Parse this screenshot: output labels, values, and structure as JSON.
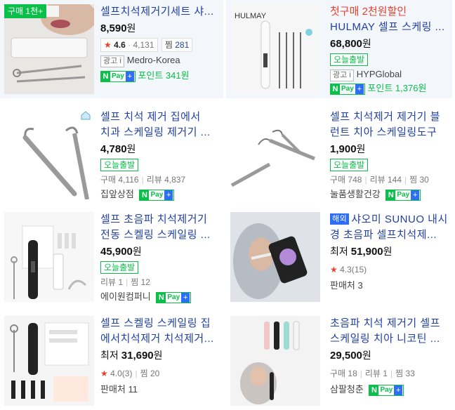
{
  "products": [
    {
      "badge": "구매 1천+",
      "title_lines": [
        "셀프치석제거기세트 샤..."
      ],
      "price": "8,590",
      "won": "원",
      "rating": "4.6",
      "review_count": "4,131",
      "zzim_label": "찜",
      "zzim": "281",
      "ad": "광고",
      "seller": "Medro-Korea",
      "point": "포인트 341원"
    },
    {
      "promo": "첫구매 2천원할인",
      "title_lines": [
        "HULMAY 셀프 스케링 ..."
      ],
      "price": "68,800",
      "won": "원",
      "arrival": "오늘출발",
      "ad": "광고",
      "seller": "HYPGlobal",
      "point": "포인트 1,376원",
      "brand": "HULMAY"
    },
    {
      "title_lines": [
        "셀프 치석 제거 집에서",
        "치과 스케일링 제거기 ..."
      ],
      "price": "4,780",
      "won": "원",
      "arrival": "오늘출발",
      "meta": [
        "구매 4,116",
        "리뷰 4,837"
      ],
      "seller": "집앞상점"
    },
    {
      "title_lines": [
        "셀프 치석제거 제거기 블",
        "런트 치아 스케일링도구"
      ],
      "price": "1,900",
      "won": "원",
      "arrival": "오늘출발",
      "meta": [
        "구매 748",
        "리뷰 144",
        "찜 30"
      ],
      "seller": "눌품생활건강"
    },
    {
      "title_lines": [
        "셀프 초음파 치석제거기",
        "전동 스켈링 스케일링 ..."
      ],
      "price": "45,900",
      "won": "원",
      "arrival": "오늘출발",
      "meta": [
        "리뷰 1",
        "찜 12"
      ],
      "seller": "에이원컴퍼니"
    },
    {
      "overseas": "해외",
      "title_lines": [
        "샤오미 SUNUO 내시",
        "경 초음파 셀프치석제..."
      ],
      "price_prefix": "최저",
      "price": "51,900",
      "won": "원",
      "rating_text": "4.3(15)",
      "sellers": "판매처 3"
    },
    {
      "title_lines": [
        "셀프 스켈링 스케일링 집",
        "에서치석제거 치석제거..."
      ],
      "price_prefix": "최저",
      "price": "31,690",
      "won": "원",
      "rating_text": "4.0(3)",
      "zzim_text": "찜 20",
      "sellers": "판매처 11"
    },
    {
      "title_lines": [
        "초음파 치석 제거기 셀프",
        "스케일링 치아 니코틴 ..."
      ],
      "price": "29,500",
      "won": "원",
      "meta": [
        "구매 18",
        "리뷰 1",
        "찜 33"
      ],
      "seller": "삼팔청춘"
    }
  ],
  "npay": {
    "n": "N",
    "pay": "Pay",
    "plus": "+"
  },
  "icons": {
    "star": "★",
    "info": "i",
    "home": "home-icon"
  },
  "colors": {
    "title": "#1f3fa8",
    "green": "#0bbf4a",
    "red": "#e8412c",
    "blue": "#2e6ef7"
  }
}
